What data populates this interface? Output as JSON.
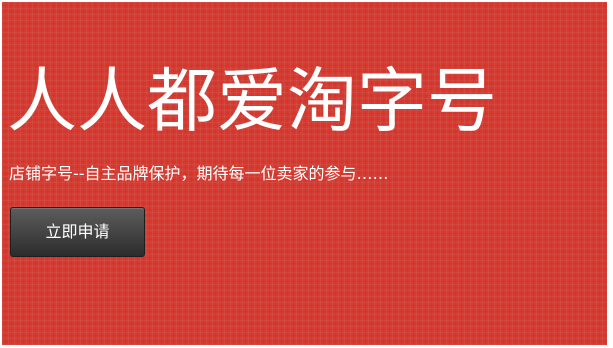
{
  "hero": {
    "title": "人人都爱淘字号",
    "subtitle": "店铺字号--自主品牌保护，期待每一位卖家的参与……",
    "button_label": "立即申请",
    "background_color": "#d93a30",
    "button_color": "#3a3a3a"
  }
}
